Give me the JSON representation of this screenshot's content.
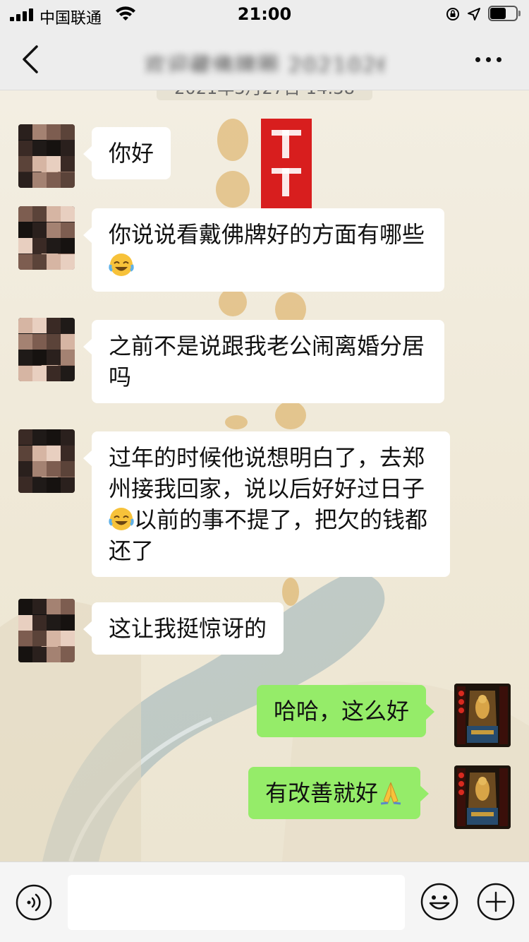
{
  "status_bar": {
    "carrier": "中国联通",
    "time": "21:00",
    "battery_level": 0.6
  },
  "nav": {
    "title": "欢迎藏佛牌圈 2021026",
    "back_icon": "chevron-left-icon",
    "more_icon": "more-dots-icon"
  },
  "chat": {
    "timestamp": "2021年3月27日 14:38",
    "messages": [
      {
        "from": "them",
        "text_a": "你好"
      },
      {
        "from": "them",
        "text_a": "你说说看戴佛牌好的方面有哪些",
        "emoji": "face-with-tears-of-joy-emoji"
      },
      {
        "from": "them",
        "text_a": "之前不是说跟我老公闹离婚分居吗"
      },
      {
        "from": "them",
        "text_a": "过年的时候他说想明白了，去郑州接我回家，说以后好好过日子",
        "text_b": "以前的事不提了，把欠的钱都还了",
        "emoji": "face-with-tears-of-joy-emoji"
      },
      {
        "from": "them",
        "text_a": "这让我挺惊讶的"
      },
      {
        "from": "me",
        "text_a": "哈哈，这么好"
      },
      {
        "from": "me",
        "text_a": "有改善就好",
        "emoji": "folded-hands-emoji"
      }
    ]
  },
  "input_bar": {
    "placeholder": "",
    "voice_icon": "voice-icon",
    "emoji_icon": "smiley-icon",
    "plus_icon": "plus-icon"
  },
  "colors": {
    "bubble_mine": "#95ec69",
    "bubble_theirs": "#ffffff",
    "bar_bg": "#ededed"
  }
}
